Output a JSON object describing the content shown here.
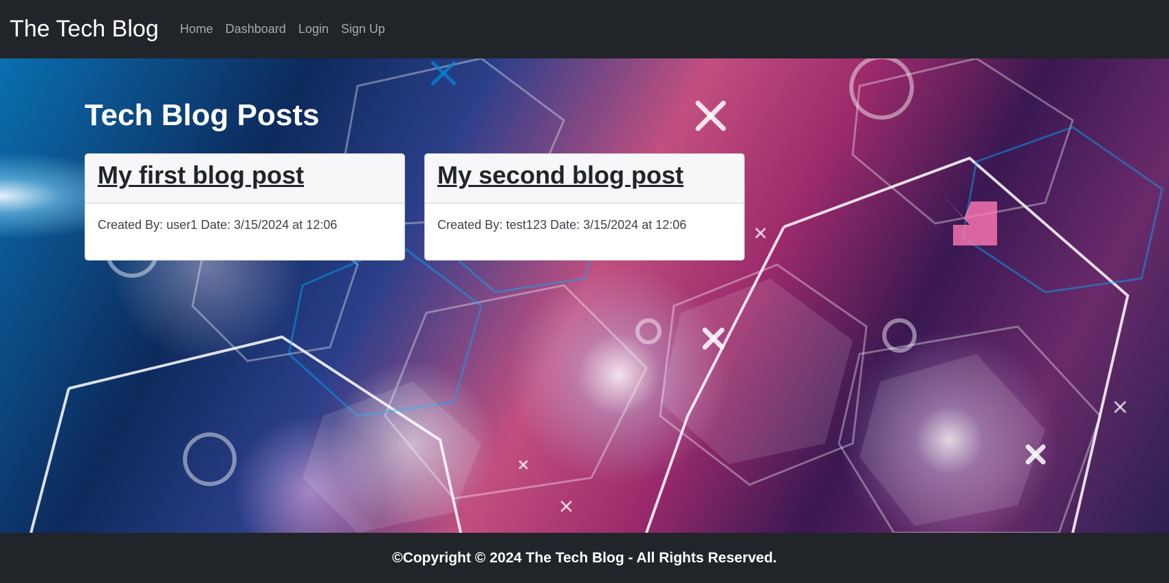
{
  "navbar": {
    "brand": "The Tech Blog",
    "links": [
      "Home",
      "Dashboard",
      "Login",
      "Sign Up"
    ]
  },
  "main": {
    "title": "Tech Blog Posts",
    "posts": [
      {
        "title": "My first blog post",
        "meta": "Created By: user1 Date: 3/15/2024 at 12:06"
      },
      {
        "title": "My second blog post",
        "meta": "Created By: test123 Date: 3/15/2024 at 12:06"
      }
    ]
  },
  "footer": {
    "text": "©Copyright © 2024 The Tech Blog - All Rights Reserved."
  },
  "colors": {
    "nav_bg": "#212529",
    "card_header_bg": "#f7f7f9",
    "text_dark": "#212529"
  },
  "icons": [
    "background-abstract-hexagon-image"
  ]
}
